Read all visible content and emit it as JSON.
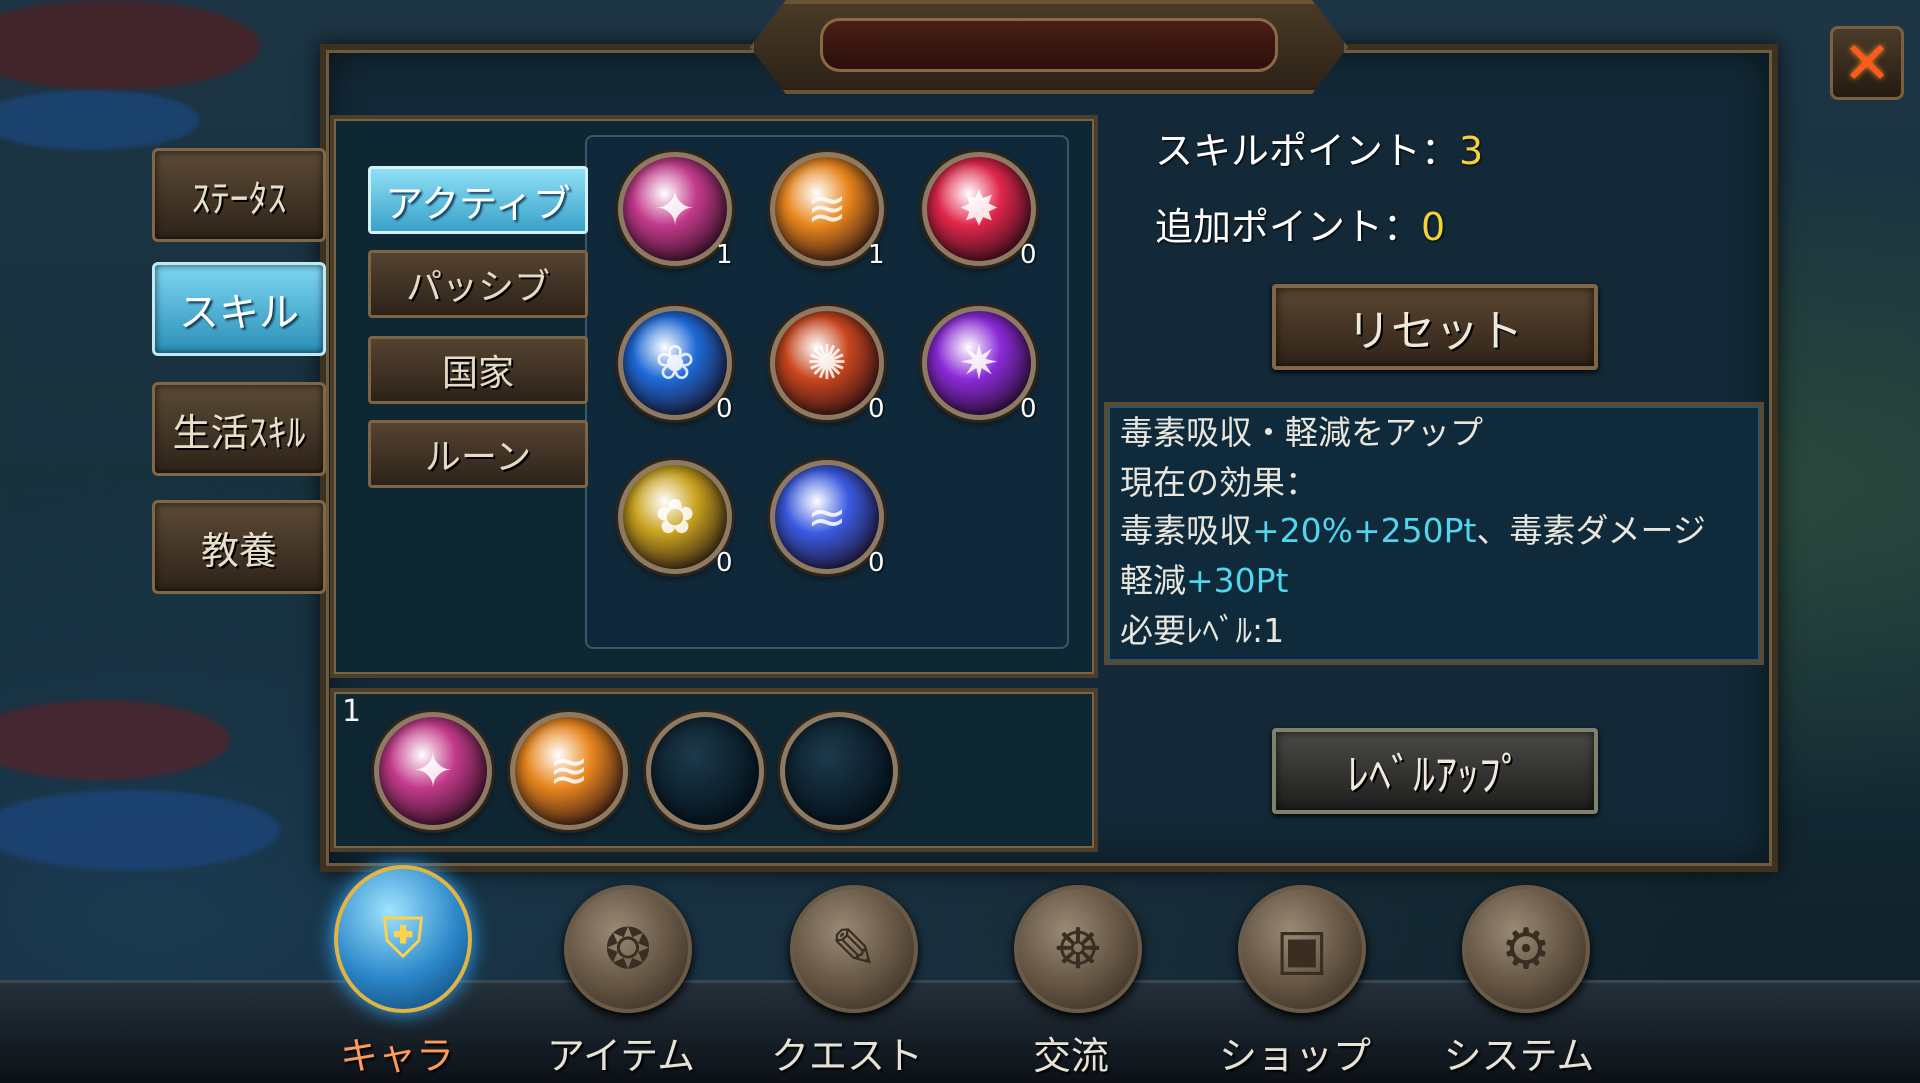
{
  "side_tabs": [
    {
      "label": "ｽﾃｰﾀｽ",
      "active": false
    },
    {
      "label": "スキル",
      "active": true
    },
    {
      "label": "生活ｽｷﾙ",
      "active": false
    },
    {
      "label": "教養",
      "active": false
    }
  ],
  "sub_tabs": [
    {
      "label": "アクティブ",
      "active": true
    },
    {
      "label": "パッシブ",
      "active": false
    },
    {
      "label": "国家",
      "active": false
    },
    {
      "label": "ルーン",
      "active": false
    }
  ],
  "skills": [
    {
      "icon": "dark-flame-claw-icon",
      "level": "1",
      "color": "#c23a8a"
    },
    {
      "icon": "fire-beam-icon",
      "level": "1",
      "color": "#e8861e"
    },
    {
      "icon": "starburst-icon",
      "level": "0",
      "color": "#e0264a"
    },
    {
      "icon": "blue-rose-icon",
      "level": "0",
      "color": "#1e6ad8"
    },
    {
      "icon": "fire-swirl-icon",
      "level": "0",
      "color": "#c8461e"
    },
    {
      "icon": "purple-vortex-icon",
      "level": "0",
      "color": "#8a2ad8"
    },
    {
      "icon": "golden-lotus-icon",
      "level": "0",
      "color": "#c8a21e"
    },
    {
      "icon": "blue-wave-icon",
      "level": "0",
      "color": "#3a5ae0"
    }
  ],
  "quickbar": {
    "page": "1",
    "slots": [
      {
        "icon": "dark-flame-claw-icon",
        "color": "#c23a8a"
      },
      {
        "icon": "fire-beam-icon",
        "color": "#e8861e"
      },
      {
        "icon": "empty-slot-icon",
        "color": ""
      },
      {
        "icon": "empty-slot-icon",
        "color": ""
      }
    ]
  },
  "info": {
    "skill_points_label": "スキルポイント：",
    "skill_points_value": "3",
    "extra_points_label": "追加ポイント：",
    "extra_points_value": "0",
    "reset_label": "リセット",
    "levelup_label": "ﾚﾍﾞﾙｱｯﾌﾟ"
  },
  "description": {
    "line1": "毒素吸収・軽減をアップ",
    "line2": "現在の効果：",
    "line3_prefix": "毒素吸収",
    "line3_highlight": "+20%+250Pt",
    "line3_suffix": "、毒素ダメージ",
    "line4_prefix": "軽減",
    "line4_highlight": "+30Pt",
    "line5": "必要ﾚﾍﾞﾙ:1"
  },
  "nav": [
    {
      "label": "キャラ",
      "icon": "knight-helmet-icon",
      "active": true
    },
    {
      "label": "アイテム",
      "icon": "item-bag-icon",
      "active": false
    },
    {
      "label": "クエスト",
      "icon": "quest-scroll-icon",
      "active": false
    },
    {
      "label": "交流",
      "icon": "social-dragon-icon",
      "active": false
    },
    {
      "label": "ショップ",
      "icon": "shop-chest-icon",
      "active": false
    },
    {
      "label": "システム",
      "icon": "system-gear-icon",
      "active": false
    }
  ],
  "colors": {
    "accent_blue": "#51d6ee",
    "value_yellow": "#f3d23a",
    "close_orange": "#ff5a1e"
  }
}
